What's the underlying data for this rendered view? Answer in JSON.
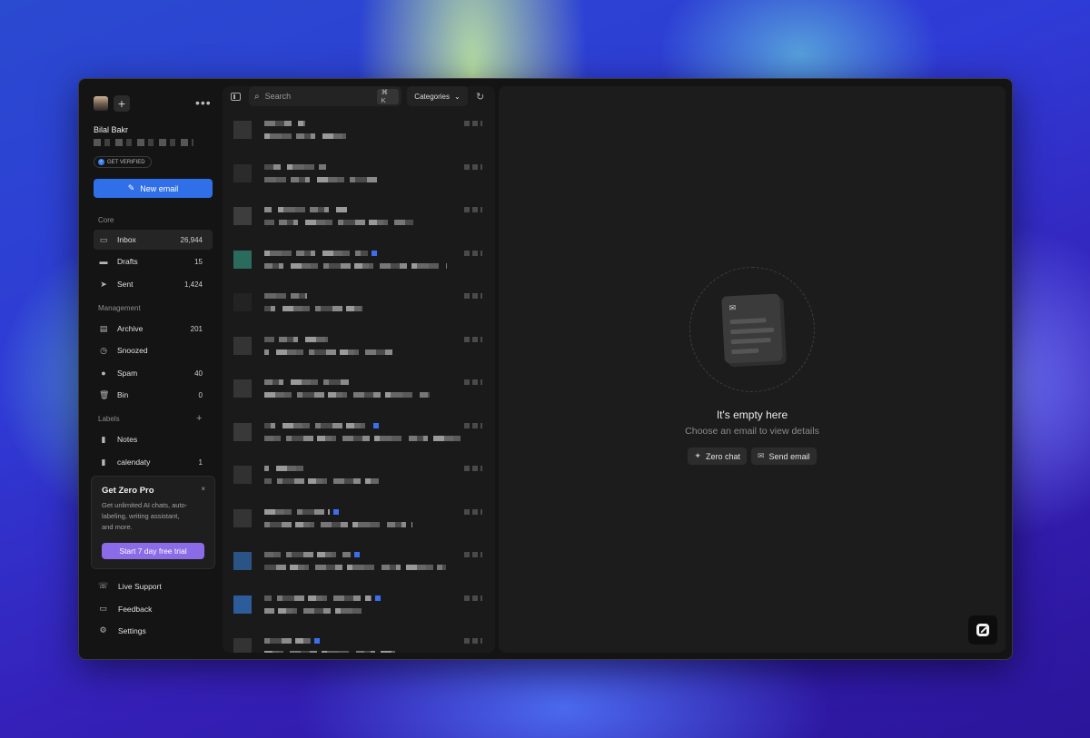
{
  "account": {
    "name": "Bilal Bakr",
    "verify_badge": "GET VERIFIED"
  },
  "actions": {
    "new_email": "New email",
    "more": "•••",
    "add": "+"
  },
  "sections": {
    "core": "Core",
    "management": "Management",
    "labels": "Labels"
  },
  "core_items": [
    {
      "label": "Inbox",
      "count": "26,944",
      "icon": "inbox-icon"
    },
    {
      "label": "Drafts",
      "count": "15",
      "icon": "folder-icon"
    },
    {
      "label": "Sent",
      "count": "1,424",
      "icon": "send-icon"
    }
  ],
  "management_items": [
    {
      "label": "Archive",
      "count": "201",
      "icon": "archive-icon"
    },
    {
      "label": "Snoozed",
      "count": "",
      "icon": "clock-icon"
    },
    {
      "label": "Spam",
      "count": "40",
      "icon": "alert-icon"
    },
    {
      "label": "Bin",
      "count": "0",
      "icon": "trash-icon"
    }
  ],
  "label_items": [
    {
      "label": "Notes",
      "count": "",
      "icon": "bookmark-icon"
    },
    {
      "label": "calendaty",
      "count": "1",
      "icon": "bookmark-icon"
    }
  ],
  "promo": {
    "title": "Get Zero Pro",
    "body": "Get unlimited AI chats, auto-labeling, writing assistant, and more.",
    "cta": "Start 7 day free trial",
    "close": "×"
  },
  "bottom_items": [
    {
      "label": "Live Support",
      "icon": "phone-icon"
    },
    {
      "label": "Feedback",
      "icon": "message-icon"
    },
    {
      "label": "Settings",
      "icon": "gear-icon"
    }
  ],
  "list": {
    "search_placeholder": "Search",
    "shortcut": "⌘ K",
    "categories": "Categories"
  },
  "empty_state": {
    "title": "It's empty here",
    "subtitle": "Choose an email to view details",
    "zero_chat": "Zero chat",
    "send_email": "Send email"
  },
  "colors": {
    "accent": "#2f6fe8",
    "promo_button": "#8b6be8",
    "unread_dot": "#3b6ff0"
  }
}
